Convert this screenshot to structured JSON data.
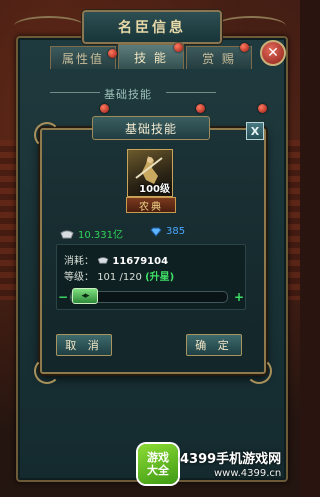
{
  "panel": {
    "title": "名臣信息",
    "tabs": [
      {
        "label": "属性值"
      },
      {
        "label": "技 能"
      },
      {
        "label": "赏 赐"
      }
    ],
    "section_label": "基础技能"
  },
  "dialog": {
    "title": "基础技能",
    "close_label": "X",
    "skill": {
      "level": "100级",
      "name": "农典"
    },
    "resources": {
      "silver": "10.331亿",
      "diamond": "385"
    },
    "cost_label": "消耗：",
    "cost_value": "11679104",
    "level_label": "等级：",
    "level_value": "101 /120",
    "level_up": "(升星)",
    "slider": {
      "minus": "−",
      "plus": "+",
      "knob": "◂▸",
      "fraction": 0.12
    },
    "cancel": "取 消",
    "confirm": "确 定"
  },
  "watermark": {
    "logo_line1": "游戏",
    "logo_line2": "大全",
    "text": "4399手机游戏网",
    "url": "www.4399.cn"
  }
}
